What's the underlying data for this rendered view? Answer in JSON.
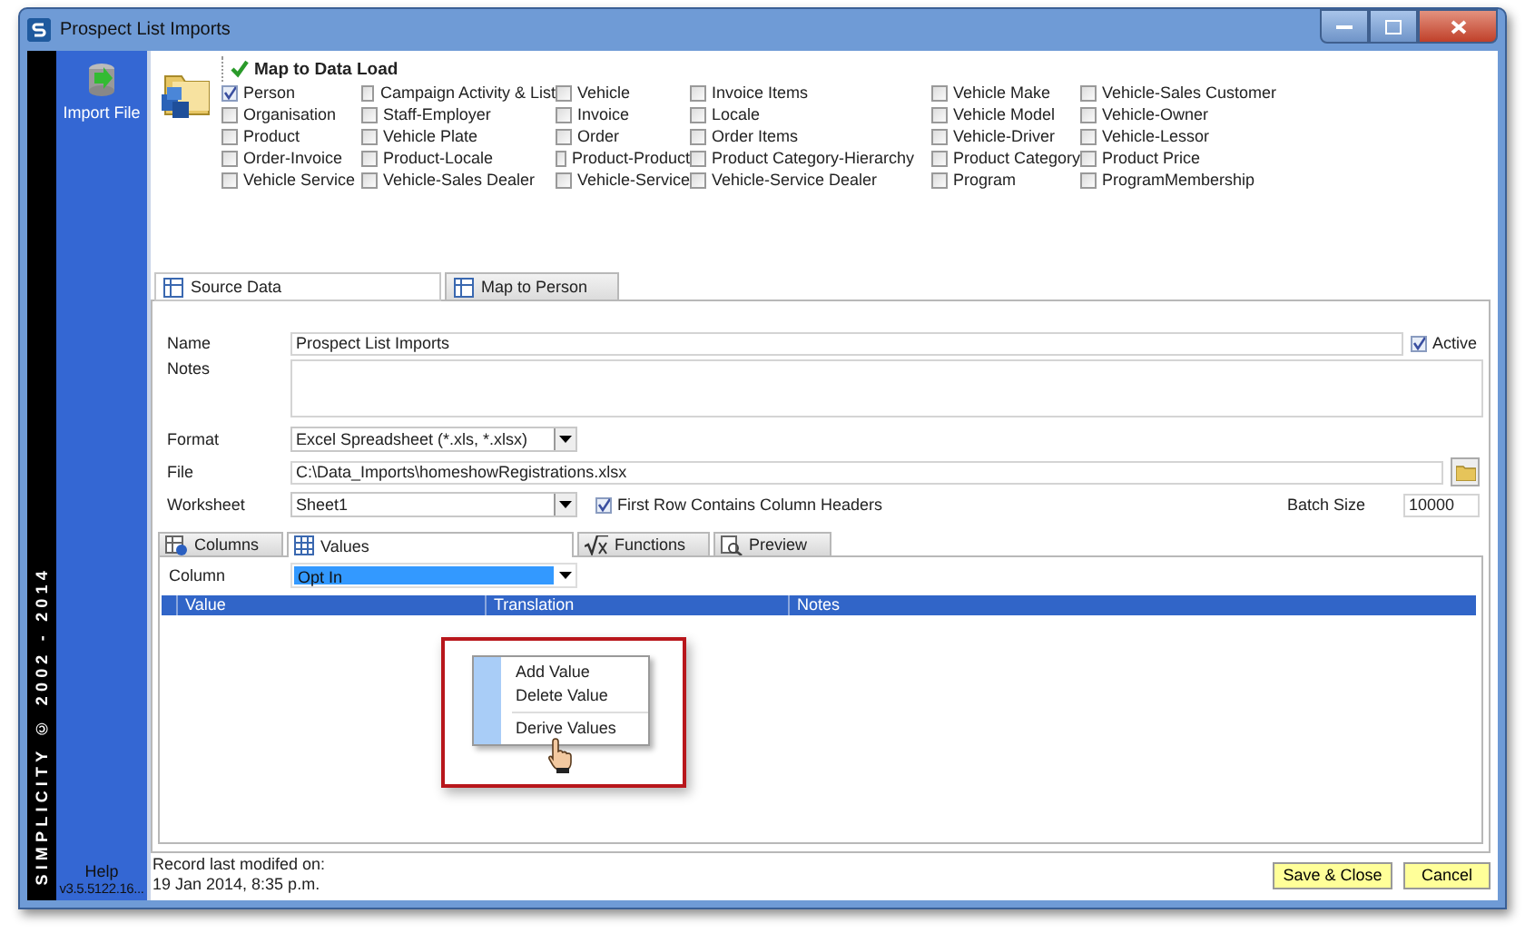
{
  "window": {
    "title": "Prospect List Imports"
  },
  "sidebar": {
    "items": [
      {
        "label": "Import File"
      }
    ],
    "copyright": "SIMPLICITY © 2002 - 2014",
    "help": "Help",
    "version": "v3.5.5122.16..."
  },
  "map_to_data_load": {
    "title": "Map to Data Load",
    "columns": [
      [
        {
          "label": "Person",
          "checked": true
        },
        {
          "label": "Organisation",
          "checked": false
        },
        {
          "label": "Product",
          "checked": false
        },
        {
          "label": "Order-Invoice",
          "checked": false
        },
        {
          "label": "Vehicle Service",
          "checked": false
        }
      ],
      [
        {
          "label": "Campaign Activity & List",
          "checked": false
        },
        {
          "label": "Staff-Employer",
          "checked": false
        },
        {
          "label": "Vehicle Plate",
          "checked": false
        },
        {
          "label": "Product-Locale",
          "checked": false
        },
        {
          "label": "Vehicle-Sales Dealer",
          "checked": false
        }
      ],
      [
        {
          "label": "Vehicle",
          "checked": false
        },
        {
          "label": "Invoice",
          "checked": false
        },
        {
          "label": "Order",
          "checked": false
        },
        {
          "label": "Product-Product",
          "checked": false
        },
        {
          "label": "Vehicle-Service",
          "checked": false
        }
      ],
      [
        {
          "label": "Invoice Items",
          "checked": false
        },
        {
          "label": "Locale",
          "checked": false
        },
        {
          "label": "Order Items",
          "checked": false
        },
        {
          "label": "Product Category-Hierarchy",
          "checked": false
        },
        {
          "label": "Vehicle-Service Dealer",
          "checked": false
        }
      ],
      [
        {
          "label": "Vehicle Make",
          "checked": false
        },
        {
          "label": "Vehicle Model",
          "checked": false
        },
        {
          "label": "Vehicle-Driver",
          "checked": false
        },
        {
          "label": "Product Category",
          "checked": false
        },
        {
          "label": "Program",
          "checked": false
        }
      ],
      [
        {
          "label": "Vehicle-Sales Customer",
          "checked": false
        },
        {
          "label": "Vehicle-Owner",
          "checked": false
        },
        {
          "label": "Vehicle-Lessor",
          "checked": false
        },
        {
          "label": "Product Price",
          "checked": false
        },
        {
          "label": "ProgramMembership",
          "checked": false
        }
      ]
    ]
  },
  "tabs": [
    {
      "label": "Source Data",
      "selected": true
    },
    {
      "label": "Map to Person",
      "selected": false
    }
  ],
  "form": {
    "name": {
      "label": "Name",
      "value": "Prospect List Imports"
    },
    "active": {
      "label": "Active",
      "checked": true
    },
    "notes": {
      "label": "Notes"
    },
    "format": {
      "label": "Format",
      "value": "Excel Spreadsheet (*.xls, *.xlsx)"
    },
    "file": {
      "label": "File",
      "value": "C:\\Data_Imports\\homeshowRegistrations.xlsx"
    },
    "worksheet": {
      "label": "Worksheet",
      "value": "Sheet1"
    },
    "first_row_headers": {
      "label": "First Row Contains Column Headers",
      "checked": true
    },
    "batch_size": {
      "label": "Batch Size",
      "value": "10000"
    }
  },
  "sub_tabs": [
    {
      "label": "Columns",
      "kind": "columns",
      "selected": false
    },
    {
      "label": "Values",
      "kind": "values",
      "selected": true
    },
    {
      "label": "Functions",
      "kind": "functions",
      "selected": false
    },
    {
      "label": "Preview",
      "kind": "preview",
      "selected": false
    }
  ],
  "column_selector": {
    "label": "Column",
    "value": "Opt In"
  },
  "table": {
    "columns": [
      "Value",
      "Translation",
      "Notes"
    ]
  },
  "context_menu": {
    "items": [
      {
        "label": "Add Value",
        "separator_before": false
      },
      {
        "label": "Delete Value",
        "separator_before": false
      },
      {
        "label": "Derive Values",
        "separator_before": true
      }
    ]
  },
  "status": {
    "label": "Record last modifed on:",
    "value": "19 Jan 2014, 8:35 p.m."
  },
  "buttons": [
    {
      "label": "Save & Close"
    },
    {
      "label": "Cancel"
    }
  ]
}
